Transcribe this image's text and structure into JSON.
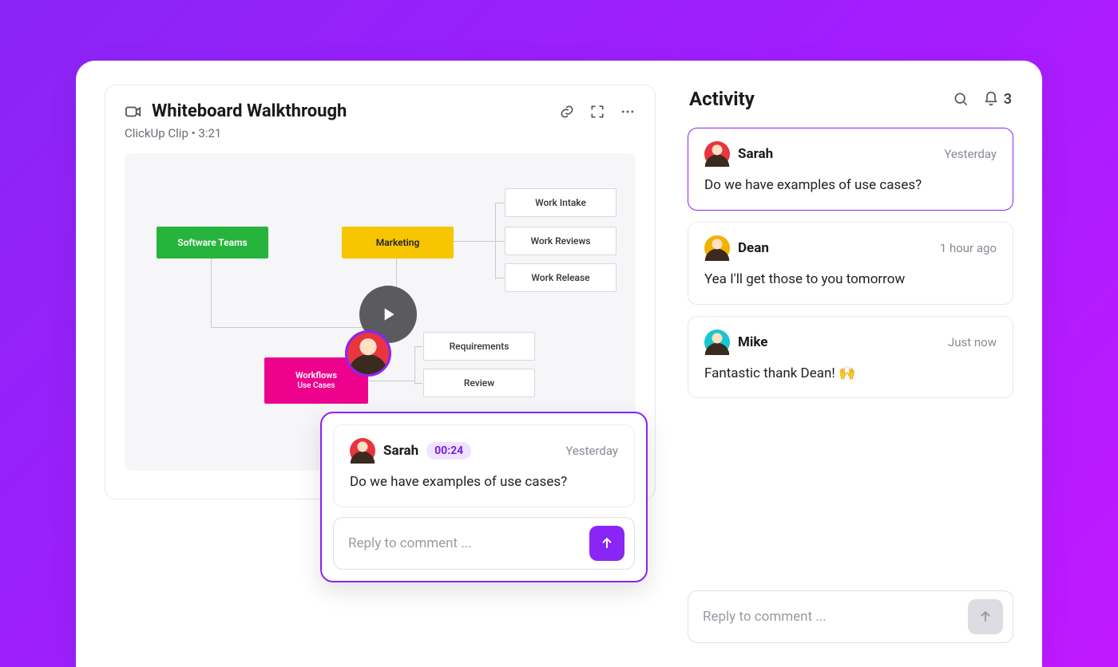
{
  "clip": {
    "title": "Whiteboard Walkthrough",
    "source": "ClickUp Clip",
    "sep": " • ",
    "duration": "3:21",
    "nodes": {
      "software_teams": "Software Teams",
      "marketing": "Marketing",
      "workflows": "Workflows",
      "workflows_sub": "Use Cases",
      "work_intake": "Work Intake",
      "work_reviews": "Work Reviews",
      "work_release": "Work Release",
      "requirements": "Requirements",
      "review": "Review"
    }
  },
  "popover": {
    "author": "Sarah",
    "timestamp": "00:24",
    "when": "Yesterday",
    "body": "Do we have examples of use cases?",
    "reply_placeholder": "Reply to comment ..."
  },
  "activity": {
    "title": "Activity",
    "notification_count": "3",
    "reply_placeholder": "Reply to comment ...",
    "comments": [
      {
        "author": "Sarah",
        "when": "Yesterday",
        "body": "Do we have examples of use cases?",
        "avatar": "av-sarah",
        "highlight": true
      },
      {
        "author": "Dean",
        "when": "1 hour ago",
        "body": "Yea I'll get those to you tomorrow",
        "avatar": "av-dean",
        "highlight": false
      },
      {
        "author": "Mike",
        "when": "Just now",
        "body": "Fantastic thank Dean! 🙌",
        "avatar": "av-mike",
        "highlight": false
      }
    ]
  }
}
